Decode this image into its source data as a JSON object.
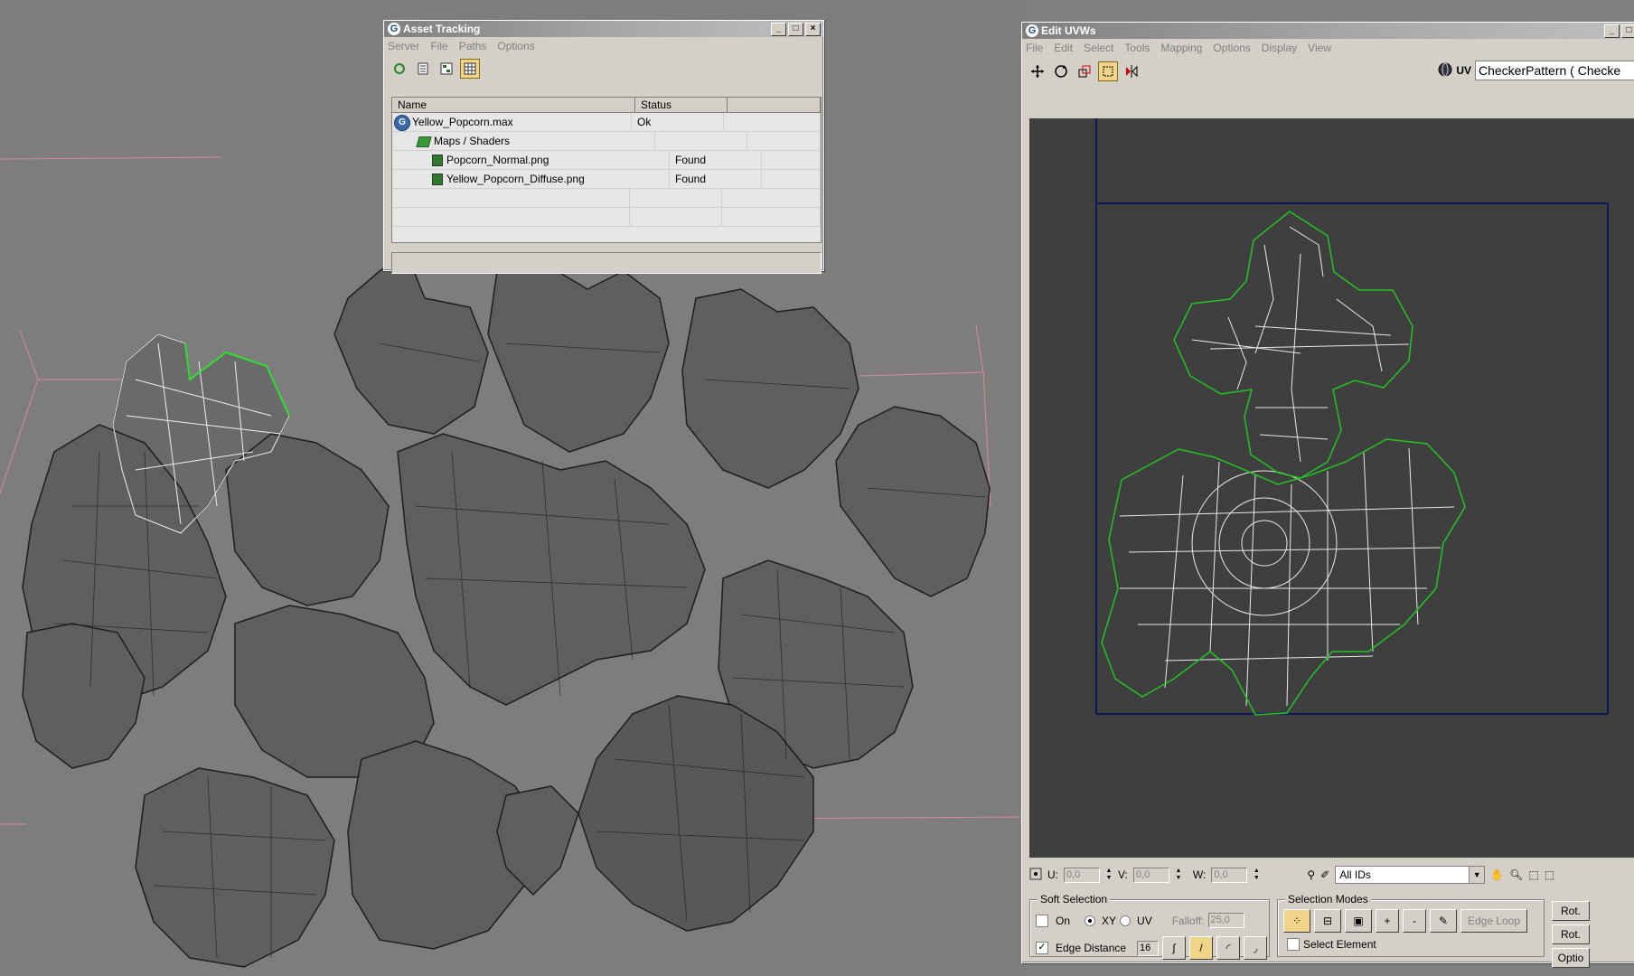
{
  "asset_tracking": {
    "title": "Asset Tracking",
    "menu": [
      "Server",
      "File",
      "Paths",
      "Options"
    ],
    "columns": {
      "name": "Name",
      "status": "Status"
    },
    "rows": [
      {
        "name": "Yellow_Popcorn.max",
        "status": "Ok"
      },
      {
        "name": "Maps / Shaders",
        "status": ""
      },
      {
        "name": "Popcorn_Normal.png",
        "status": "Found"
      },
      {
        "name": "Yellow_Popcorn_Diffuse.png",
        "status": "Found"
      }
    ],
    "toolbar_icons": [
      "refresh-icon",
      "list-icon",
      "tree-icon",
      "table-icon"
    ]
  },
  "edit_uvws": {
    "title": "Edit UVWs",
    "menu": [
      "File",
      "Edit",
      "Select",
      "Tools",
      "Mapping",
      "Options",
      "Display",
      "View"
    ],
    "uv_label": "UV",
    "texture_dropdown": "CheckerPattern  ( Checke",
    "coords": {
      "u_label": "U:",
      "u_value": "0,0",
      "v_label": "V:",
      "v_value": "0,0",
      "w_label": "W:",
      "w_value": "0,0"
    },
    "ids_dropdown": "All IDs",
    "soft_selection": {
      "title": "Soft Selection",
      "on_label": "On",
      "xy_label": "XY",
      "uv_label": "UV",
      "falloff_label": "Falloff:",
      "falloff_value": "25,0",
      "edge_distance_label": "Edge Distance",
      "edge_distance_value": "16"
    },
    "selection_modes": {
      "title": "Selection Modes",
      "plus": "+",
      "minus": "-",
      "edge_loop": "Edge Loop",
      "select_element": "Select Element"
    },
    "side_buttons": [
      "Rot.",
      "Rot.",
      "Optio"
    ]
  },
  "colors": {
    "viewport_bg": "#7d7d7d",
    "uv_bg": "#3f3f3f",
    "uv_border": "#0c1a5c",
    "uv_seam": "#22c022",
    "window_face": "#d4d0c8"
  }
}
